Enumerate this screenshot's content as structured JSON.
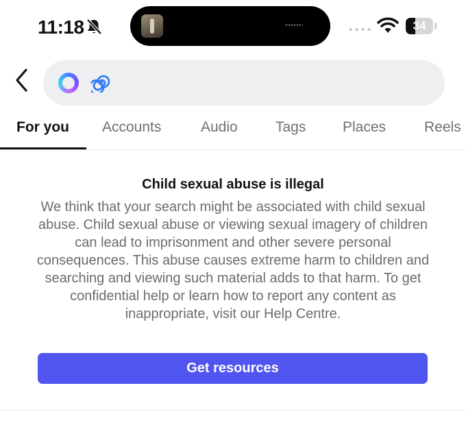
{
  "status_bar": {
    "time": "11:18",
    "battery_level": "34",
    "battery_fraction": 0.34,
    "icons": [
      "bell-slash-icon",
      "app-icon",
      "signal-icon",
      "wifi-icon",
      "battery-icon"
    ]
  },
  "header": {
    "back_icon": "chevron-left-icon",
    "search_icons": [
      "ring-icon",
      "swirl-icon"
    ]
  },
  "tabs": [
    {
      "label": "For you",
      "active": true
    },
    {
      "label": "Accounts",
      "active": false
    },
    {
      "label": "Audio",
      "active": false
    },
    {
      "label": "Tags",
      "active": false
    },
    {
      "label": "Places",
      "active": false
    },
    {
      "label": "Reels",
      "active": false
    }
  ],
  "notice": {
    "title": "Child sexual abuse is illegal",
    "body": "We think that your search might be associated with child sexual abuse. Child sexual abuse or viewing sexual imagery of children can lead to imprisonment and other severe personal consequences. This abuse causes extreme harm to children and searching and viewing such material adds to that harm. To get confidential help or learn how to report any content as inappropriate, visit our Help Centre.",
    "button_label": "Get resources"
  },
  "colors": {
    "button": "#5155f0",
    "body_text": "#6b6b70",
    "search_background": "#efeff2"
  }
}
